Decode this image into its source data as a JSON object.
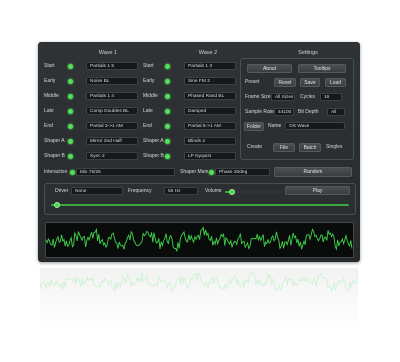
{
  "headers": {
    "wave1": "Wave 1",
    "wave2": "Wave 2",
    "settings": "Settings"
  },
  "rows": [
    {
      "label": "Start",
      "w1": "Partials 1 5",
      "w2": "Partials 1 3"
    },
    {
      "label": "Early",
      "w1": "Noise BL",
      "w2": "Sine FM 2"
    },
    {
      "label": "Middle",
      "w1": "Partials 1 4",
      "w2": "Phased Rand BL"
    },
    {
      "label": "Late",
      "w1": "Comp Doubles BL",
      "w2": "Damped"
    },
    {
      "label": "End",
      "w1": "Partial 3->1 AM",
      "w2": "Partial 8->1 AM"
    },
    {
      "label": "Shaper A",
      "w1": "Mirror 2nd Half",
      "w2": "Blinds 2"
    },
    {
      "label": "Shaper B",
      "w1": "Sync 2",
      "w2": "LP Nyquist"
    }
  ],
  "interaction": {
    "label": "Interaction",
    "value": "Mix 75/25"
  },
  "shaper_main": {
    "label": "Shaper Main",
    "value": "Phase 30deg"
  },
  "random_button": "Random",
  "settings": {
    "about": "About",
    "tooltips": "Tooltips",
    "preset_label": "Preset",
    "reset": "Reset",
    "save": "Save",
    "load": "Load",
    "frame_size_label": "Frame Size",
    "frame_size_value": "All Sizes",
    "cycles_label": "Cycles",
    "cycles_value": "16",
    "sample_rate_label": "Sample Rate",
    "sample_rate_value": "44100",
    "bit_depth_label": "Bit Depth",
    "bit_depth_value": "All",
    "folder": "Folder",
    "name_label": "Name",
    "name_value": "OS Wave",
    "create_label": "Create",
    "file": "File",
    "batch": "Batch",
    "singles": "Singles"
  },
  "player": {
    "driver_label": "Driver",
    "driver_value": "None",
    "frequency_label": "Frequency",
    "frequency_value": "55 Hz",
    "volume_label": "Volume",
    "play": "Play",
    "volume_level": 0.12,
    "position_level": 0.02
  },
  "colors": {
    "accent": "#4cdc52",
    "panel": "#2b2f31",
    "waveform": "#3fd24a"
  }
}
